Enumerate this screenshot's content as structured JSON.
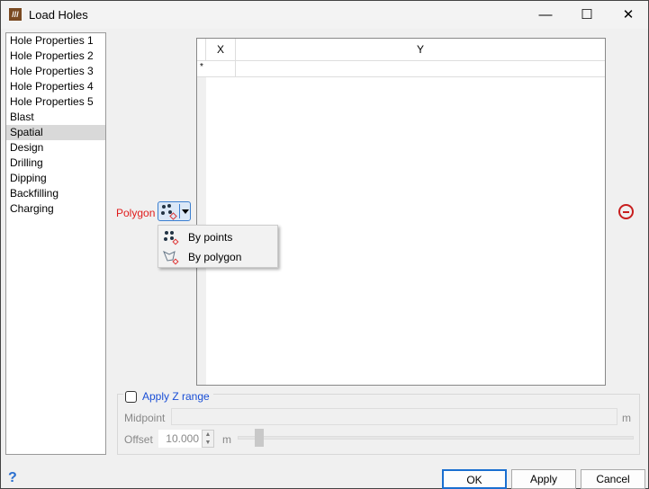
{
  "window": {
    "title": "Load Holes",
    "minimize": "—",
    "maximize": "☐",
    "close": "✕"
  },
  "sidebar": {
    "items": [
      {
        "label": "Hole Properties 1"
      },
      {
        "label": "Hole Properties 2"
      },
      {
        "label": "Hole Properties 3"
      },
      {
        "label": "Hole Properties 4"
      },
      {
        "label": "Hole Properties 5"
      },
      {
        "label": "Blast"
      },
      {
        "label": "Spatial"
      },
      {
        "label": "Design"
      },
      {
        "label": "Drilling"
      },
      {
        "label": "Dipping"
      },
      {
        "label": "Backfilling"
      },
      {
        "label": "Charging"
      }
    ],
    "selected": "Spatial"
  },
  "grid": {
    "columns": [
      "X",
      "Y"
    ],
    "new_row_marker": "*"
  },
  "polygon": {
    "label": "Polygon",
    "menu": [
      {
        "label": "By points",
        "icon": "points-icon"
      },
      {
        "label": "By polygon",
        "icon": "polygon-icon"
      }
    ]
  },
  "zrange": {
    "checkbox_label": "Apply Z range",
    "checked": false,
    "midpoint_label": "Midpoint",
    "midpoint_value": "",
    "midpoint_unit": "m",
    "offset_label": "Offset",
    "offset_value": "10.000",
    "offset_unit": "m"
  },
  "buttons": {
    "ok": "OK",
    "apply": "Apply",
    "cancel": "Cancel",
    "help": "?"
  }
}
